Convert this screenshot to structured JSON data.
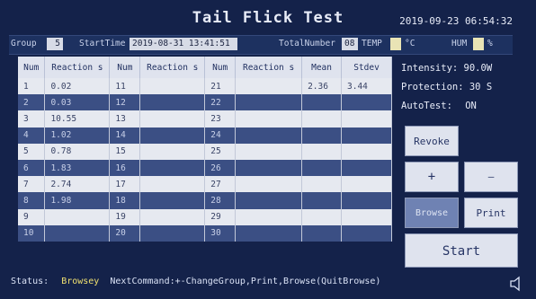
{
  "app": {
    "title": "Tail Flick Test",
    "datetime": "2019-09-23  06:54:32"
  },
  "info": {
    "group_label": "Group",
    "group_value": "5",
    "start_label": "StartTime",
    "start_value": "2019-08-31 13:41:51",
    "total_label": "TotalNumber",
    "total_value": "08",
    "temp_label": "TEMP",
    "temp_unit": "°C",
    "hum_label": "HUM",
    "hum_unit": "%"
  },
  "table": {
    "headers": [
      "Num",
      "Reaction s",
      "Num",
      "Reaction s",
      "Num",
      "Reaction s",
      "Mean",
      "Stdev"
    ],
    "rows": [
      [
        "1",
        "0.02",
        "11",
        "",
        "21",
        "",
        "2.36",
        "3.44"
      ],
      [
        "2",
        "0.03",
        "12",
        "",
        "22",
        "",
        "",
        ""
      ],
      [
        "3",
        "10.55",
        "13",
        "",
        "23",
        "",
        "",
        ""
      ],
      [
        "4",
        "1.02",
        "14",
        "",
        "24",
        "",
        "",
        ""
      ],
      [
        "5",
        "0.78",
        "15",
        "",
        "25",
        "",
        "",
        ""
      ],
      [
        "6",
        "1.83",
        "16",
        "",
        "26",
        "",
        "",
        ""
      ],
      [
        "7",
        "2.74",
        "17",
        "",
        "27",
        "",
        "",
        ""
      ],
      [
        "8",
        "1.98",
        "18",
        "",
        "28",
        "",
        "",
        ""
      ],
      [
        "9",
        "",
        "19",
        "",
        "29",
        "",
        "",
        ""
      ],
      [
        "10",
        "",
        "20",
        "",
        "30",
        "",
        "",
        ""
      ]
    ]
  },
  "side": {
    "intensity": "Intensity: 90.0W",
    "protection": "Protection: 30  S",
    "autotest_label": "AutoTest:",
    "autotest_value": "ON",
    "revoke": "Revoke",
    "plus": "+",
    "minus": "—",
    "browse": "Browse",
    "print": "Print",
    "start": "Start"
  },
  "status": {
    "label": "Status:",
    "state": "Browsey",
    "next": "NextCommand:+-ChangeGroup,Print,Browse(QuitBrowse)"
  }
}
